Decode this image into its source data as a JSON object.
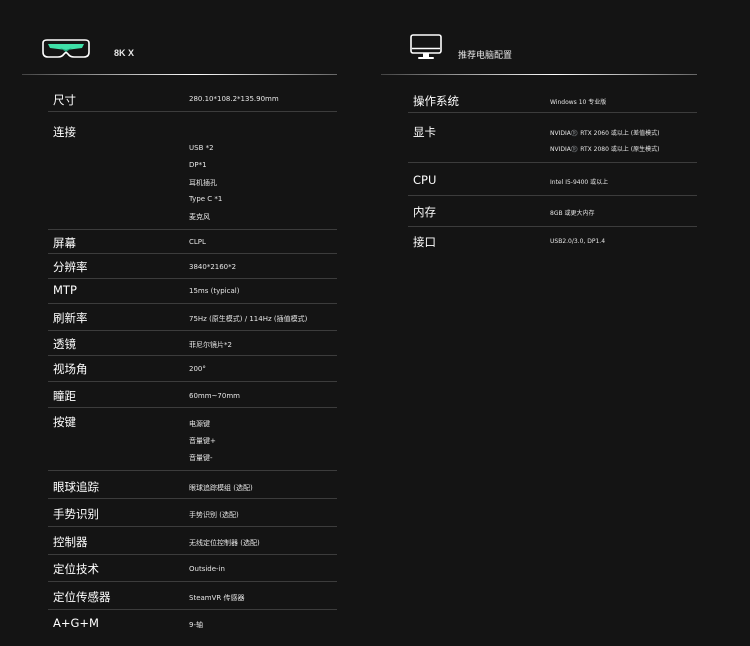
{
  "left": {
    "title": "8K X",
    "icon": "vr-headset-icon",
    "rows": [
      {
        "label": "尺寸",
        "value": "280.10*108.2*135.90mm"
      },
      {
        "label": "连接",
        "values": [
          "USB *2",
          "DP*1",
          "耳机插孔",
          "Type C *1",
          "麦克风"
        ]
      },
      {
        "label": "屏幕",
        "value": "CLPL"
      },
      {
        "label": "分辨率",
        "value": "3840*2160*2"
      },
      {
        "label": "MTP",
        "value": "15ms (typical)"
      },
      {
        "label": "刷新率",
        "value": "75Hz (原生模式) / 114Hz (插值模式)"
      },
      {
        "label": "透镜",
        "value": "菲尼尔镜片*2"
      },
      {
        "label": "视场角",
        "value": "200°"
      },
      {
        "label": "瞳距",
        "value": "60mm~70mm"
      },
      {
        "label": "按键",
        "values": [
          "电源键",
          "音量键+",
          "音量键-"
        ]
      },
      {
        "label": "眼球追踪",
        "value": "眼球追踪模组 (选配)"
      },
      {
        "label": "手势识别",
        "value": "手势识别 (选配)"
      },
      {
        "label": "控制器",
        "value": "无线定位控制器 (选配)"
      },
      {
        "label": "定位技术",
        "value": "Outside-in"
      },
      {
        "label": "定位传感器",
        "value": "SteamVR 传感器"
      },
      {
        "label": "A+G+M",
        "value": "9-轴"
      }
    ]
  },
  "right": {
    "title": "推荐电脑配置",
    "icon": "monitor-icon",
    "rows": [
      {
        "label": "操作系统",
        "value": "Windows 10 专业版"
      },
      {
        "label": "显卡",
        "values": [
          "NVIDIA®️ RTX 2060 或以上 (差值模式)",
          "NVIDIA®️ RTX 2080 或以上 (原生模式)"
        ]
      },
      {
        "label": "CPU",
        "value": "Intel I5-9400 或以上"
      },
      {
        "label": "内存",
        "value": "8GB 或更大内存"
      },
      {
        "label": "接口",
        "value": "USB2.0/3.0, DP1.4"
      }
    ]
  },
  "colors": {
    "background": "#141414",
    "accent": "#3fe0a8",
    "divider": "#3c3c3c"
  }
}
